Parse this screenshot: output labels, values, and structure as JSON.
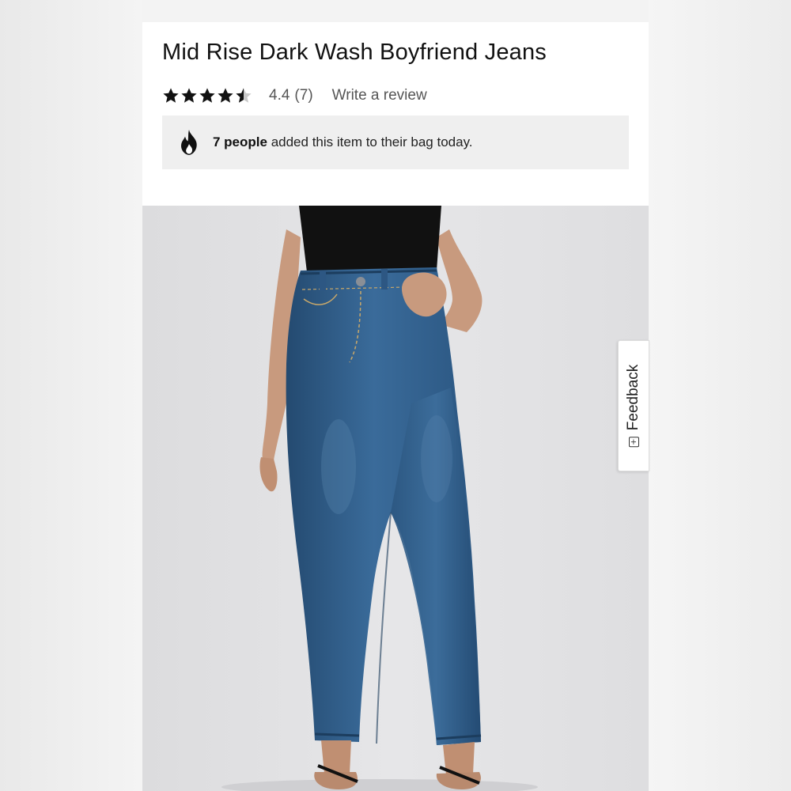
{
  "product": {
    "title": "Mid Rise Dark Wash Boyfriend Jeans",
    "rating": {
      "stars_filled": 4.4,
      "stars_total": 5,
      "score_text": "4.4",
      "count_text": "(7)",
      "write_review_label": "Write a review"
    },
    "social_proof": {
      "icon": "flame-icon",
      "bold_text": "7 people",
      "rest_text": " added this item to their bag today."
    },
    "image": {
      "subject": "product-photo-jeans"
    }
  },
  "feedback": {
    "label": "Feedback",
    "icon_glyph": "+"
  },
  "colors": {
    "star": "#111111",
    "star_empty": "#c8c8c8",
    "notice_bg": "#efefef",
    "photo_bg": "#e2e2e4",
    "denim": "#2f5b86"
  }
}
